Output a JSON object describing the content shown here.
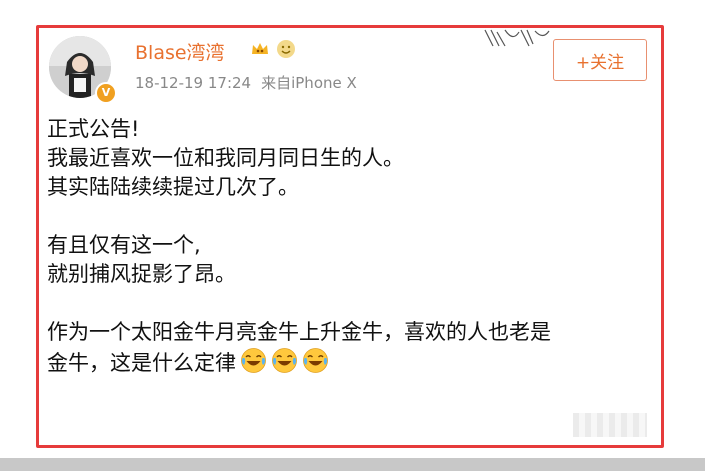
{
  "post": {
    "username": "Blase湾湾",
    "timestamp": "18-12-19 17:24",
    "source": "来自iPhone X",
    "follow_label": "+关注",
    "badges": [
      "vip-crown-icon",
      "emoji-badge-icon"
    ],
    "paragraphs": [
      [
        "正式公告!",
        "我最近喜欢一位和我同月同日生的人。",
        "其实陆陆续续提过几次了。"
      ],
      [
        "有且仅有这一个,",
        "就别捕风捉影了昂。"
      ],
      [
        "作为一个太阳金牛月亮金牛上升金牛，喜欢的人也老是",
        "金牛，这是什么定律"
      ]
    ],
    "trailing_emojis": [
      "laugh-cry-emoji",
      "laugh-cry-emoji",
      "laugh-cry-emoji"
    ]
  },
  "colors": {
    "highlight_border": "#e63b3b",
    "username": "#e8712f",
    "follow_button": "#e8712f",
    "meta_text": "#888888",
    "body_text": "#111111"
  }
}
